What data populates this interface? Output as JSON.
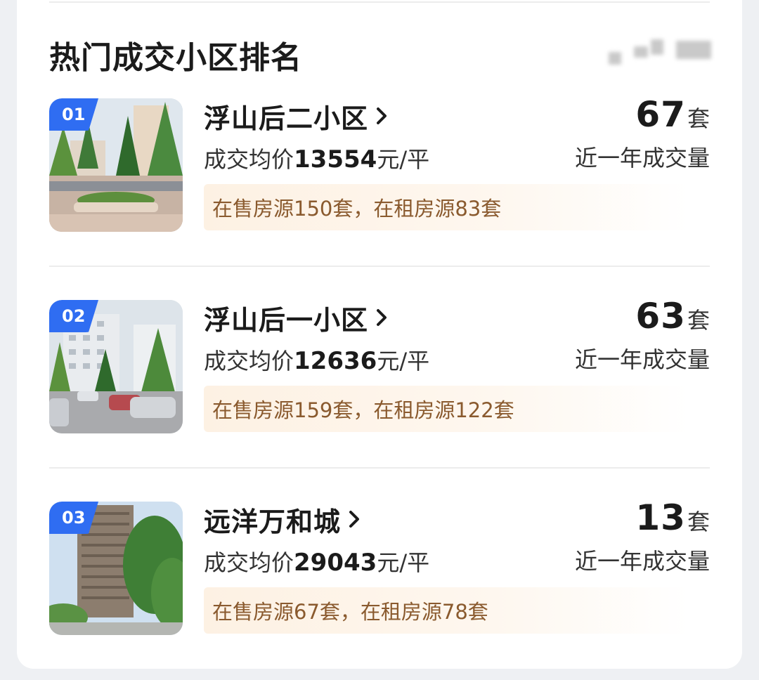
{
  "section": {
    "title": "热门成交小区排名"
  },
  "listings": [
    {
      "rank": "01",
      "name": "浮山后二小区",
      "price_prefix": "成交均价",
      "price": "13554",
      "price_unit": "元/平",
      "listing_info": "在售房源150套，在租房源83套",
      "deal_count": "67",
      "deal_unit": "套",
      "deal_label": "近一年成交量"
    },
    {
      "rank": "02",
      "name": "浮山后一小区",
      "price_prefix": "成交均价",
      "price": "12636",
      "price_unit": "元/平",
      "listing_info": "在售房源159套，在租房源122套",
      "deal_count": "63",
      "deal_unit": "套",
      "deal_label": "近一年成交量"
    },
    {
      "rank": "03",
      "name": "远洋万和城",
      "price_prefix": "成交均价",
      "price": "29043",
      "price_unit": "元/平",
      "listing_info": "在售房源67套，在租房源78套",
      "deal_count": "13",
      "deal_unit": "套",
      "deal_label": "近一年成交量"
    }
  ],
  "colors": {
    "badge": "#2f6df2",
    "listing_text": "#8a5a2e",
    "listing_bg": "#fdf1e3"
  },
  "icons": {
    "more_link": "chevron-right-icon"
  }
}
